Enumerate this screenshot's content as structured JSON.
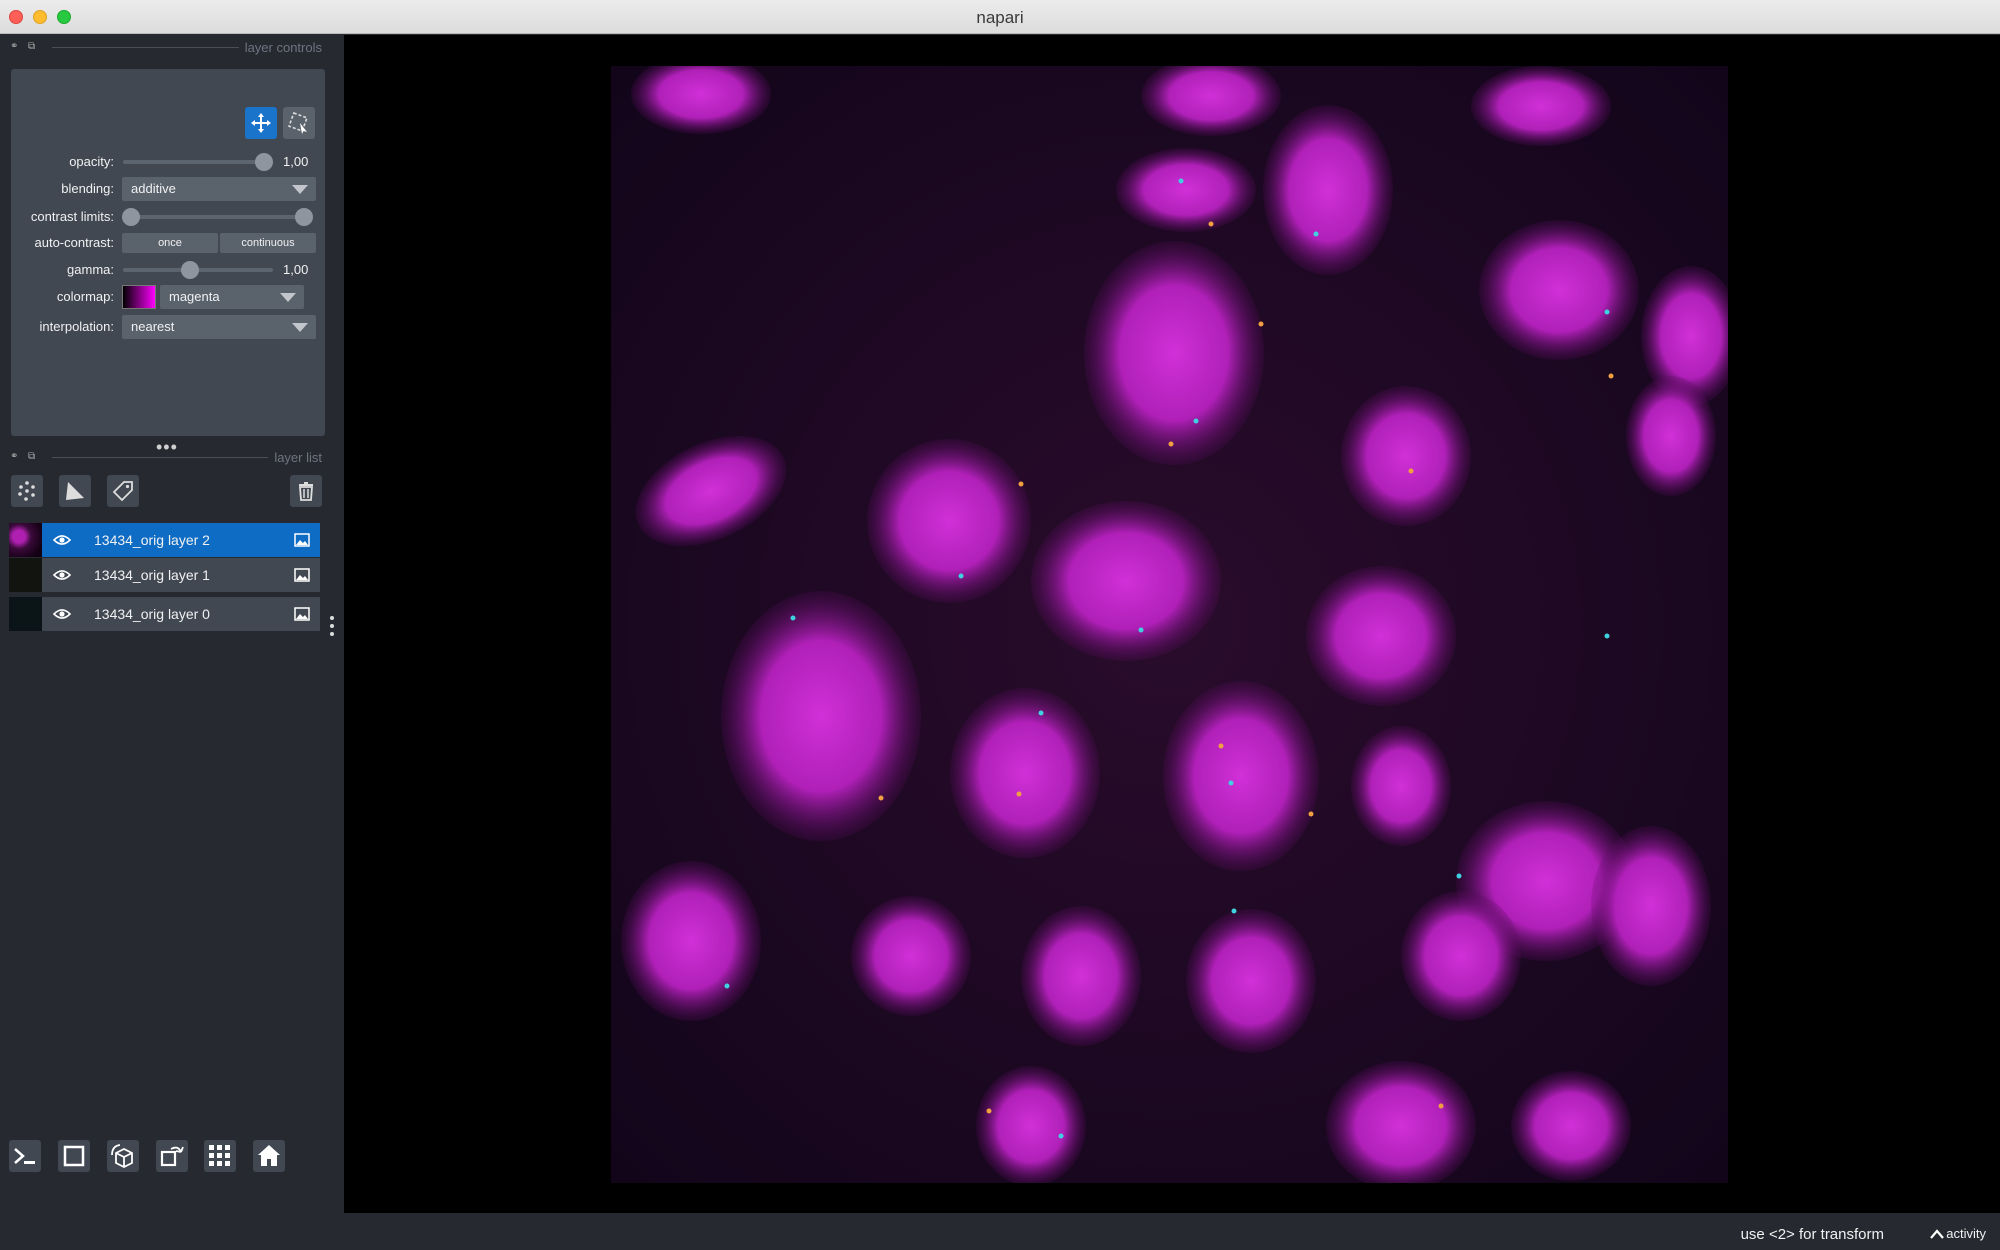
{
  "window": {
    "title": "napari"
  },
  "layer_controls": {
    "header": "layer controls",
    "opacity": {
      "label": "opacity:",
      "value": "1,00",
      "level": 1.0
    },
    "blending": {
      "label": "blending:",
      "value": "additive"
    },
    "contrast_limits": {
      "label": "contrast limits:",
      "range": [
        0.0,
        1.0
      ]
    },
    "auto_contrast": {
      "label": "auto-contrast:",
      "once": "once",
      "continuous": "continuous"
    },
    "gamma": {
      "label": "gamma:",
      "value": "1,00",
      "level": 0.5
    },
    "colormap": {
      "label": "colormap:",
      "value": "magenta",
      "color": "#ff00ff"
    },
    "interpolation": {
      "label": "interpolation:",
      "value": "nearest"
    },
    "mode_buttons": [
      "pan-zoom-icon",
      "transform-icon"
    ]
  },
  "layer_list": {
    "header": "layer list",
    "tools": [
      "new-points-icon",
      "new-shapes-icon",
      "new-labels-icon",
      "delete-icon"
    ],
    "layers": [
      {
        "name": "13434_orig layer 2",
        "selected": true,
        "visible": true,
        "type_icon": "image-icon"
      },
      {
        "name": "13434_orig layer 1",
        "selected": false,
        "visible": true,
        "type_icon": "image-icon"
      },
      {
        "name": "13434_orig layer 0",
        "selected": false,
        "visible": true,
        "type_icon": "image-icon"
      }
    ]
  },
  "bottom_toolbar": [
    "console-icon",
    "ndisplay-icon",
    "roll-icon",
    "transpose-icon",
    "grid-icon",
    "home-icon"
  ],
  "status": {
    "text": "use <2> for transform",
    "activity": "activity"
  },
  "colors": {
    "accent": "#1a74ca",
    "panel": "#414851",
    "background": "#262930",
    "canvas": "#000000"
  }
}
